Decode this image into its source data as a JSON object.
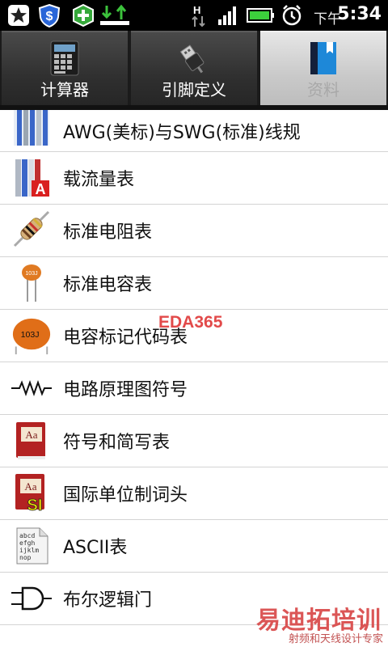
{
  "status_bar": {
    "icons": [
      "app-star-icon",
      "shield-dollar-icon",
      "green-plus-icon",
      "download-icon",
      "network-h-icon",
      "signal-icon",
      "battery-icon",
      "alarm-icon"
    ],
    "ampm": "下午",
    "time": "5:34"
  },
  "tabs": [
    {
      "label": "计算器",
      "icon": "calculator-icon",
      "active": false
    },
    {
      "label": "引脚定义",
      "icon": "usb-plug-icon",
      "active": false
    },
    {
      "label": "资料",
      "icon": "book-icon",
      "active": true
    }
  ],
  "list": {
    "items": [
      {
        "label": "AWG(美标)与SWG(标准)线规",
        "icon": "wire-gauge-icon"
      },
      {
        "label": "载流量表",
        "icon": "wire-current-icon"
      },
      {
        "label": "标准电阻表",
        "icon": "resistor-icon"
      },
      {
        "label": "标准电容表",
        "icon": "capacitor-icon"
      },
      {
        "label": "电容标记代码表",
        "icon": "ceramic-capacitor-icon"
      },
      {
        "label": "电路原理图符号",
        "icon": "zigzag-resistor-symbol-icon"
      },
      {
        "label": "符号和简写表",
        "icon": "red-book-icon"
      },
      {
        "label": "国际单位制词头",
        "icon": "si-book-icon"
      },
      {
        "label": "ASCII表",
        "icon": "ascii-page-icon"
      },
      {
        "label": "布尔逻辑门",
        "icon": "and-gate-icon"
      }
    ]
  },
  "capacitor_marking": "103J",
  "book_icon_text": "Aa",
  "si_badge_text": "SI",
  "ascii_icon_lines": [
    "abcd",
    "efgh",
    "ijklm",
    "nop"
  ],
  "watermarks": {
    "eda": "EDA365",
    "cn": "易迪拓培训",
    "cn_sub": "射频和天线设计专家"
  },
  "colors": {
    "statusbar_bg": "#000000",
    "tab_bg": "#303030",
    "tab_active_bg": "#c9c9c9",
    "divider": "#d4d4d4",
    "watermark": "#e24a4a"
  }
}
